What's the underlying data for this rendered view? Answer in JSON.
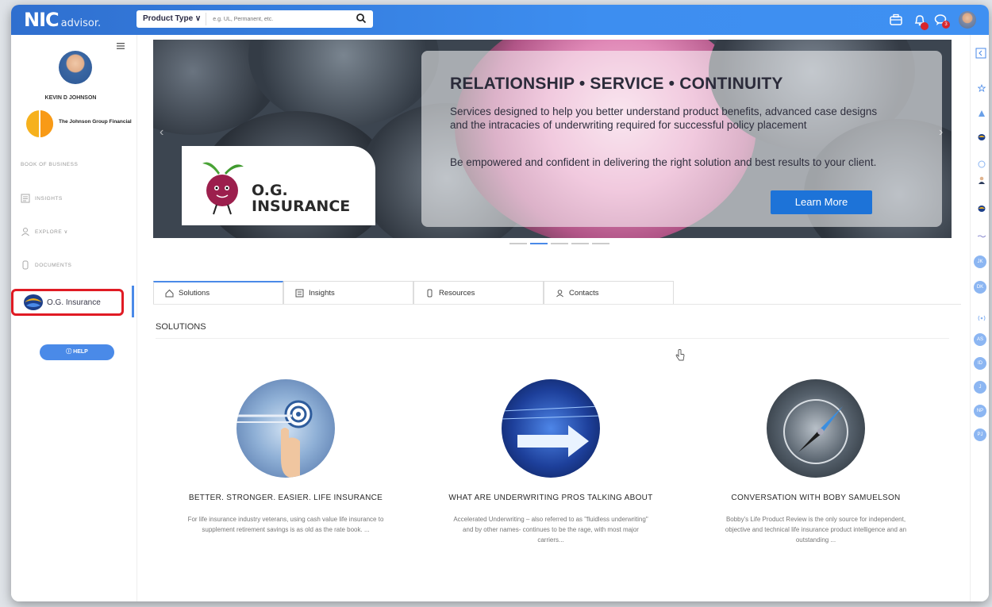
{
  "app": {
    "logo_main": "NIC",
    "logo_sub": "advisor."
  },
  "search": {
    "product_type": "Product Type ∨",
    "placeholder": "e.g. UL, Permanent, etc."
  },
  "topbar_icons": [
    "briefcase-icon",
    "bell-icon",
    "chat-icon",
    "user-avatar"
  ],
  "notifications": {
    "bell_badge": "",
    "chat_badge": "3"
  },
  "sidebar": {
    "user_name": "KEVIN D JOHNSON",
    "company_name": "The Johnson Group Financial",
    "items": [
      {
        "label": "BOOK OF BUSINESS"
      },
      {
        "label": "INSIGHTS"
      },
      {
        "label": "EXPLORE ∨"
      },
      {
        "label": "DOCUMENTS"
      }
    ],
    "active_item": "O.G. Insurance",
    "help_label": "HELP"
  },
  "banner": {
    "title": "RELATIONSHIP • SERVICE • CONTINUITY",
    "text1": "Services designed to help you better understand product benefits, advanced case designs and the intracacies of underwriting required for successful policy placement",
    "text2": "Be empowered and confident in delivering the right solution and best results to your client.",
    "button": "Learn More",
    "brand_line1": "O.G.",
    "brand_line2": "INSURANCE",
    "prev": "‹",
    "next": "›"
  },
  "tabs": [
    {
      "label": "Solutions",
      "icon": "home-icon"
    },
    {
      "label": "Insights",
      "icon": "list-icon"
    },
    {
      "label": "Resources",
      "icon": "document-icon"
    },
    {
      "label": "Contacts",
      "icon": "user-icon"
    }
  ],
  "section_title": "SOLUTIONS",
  "cards": [
    {
      "title": "BETTER. STRONGER. EASIER. LIFE INSURANCE",
      "text": "For life insurance industry veterans, using cash value life insurance to supplement retirement savings is as old as the rate book. ..."
    },
    {
      "title": "WHAT ARE UNDERWRITING PROS TALKING ABOUT",
      "text": "Accelerated Underwriting – also referred to as \"fluidless underwriting\" and by other names- continues to be the rage, with most major carriers..."
    },
    {
      "title": "CONVERSATION WITH BOBY SAMUELSON",
      "text": "Bobby's Life Product Review is the only source for independent, objective and technical life insurance product intelligence and an outstanding ..."
    }
  ],
  "rail_initials": [
    "JK",
    "DK",
    "AS",
    "ID",
    "J",
    "NP",
    "PJ"
  ],
  "colors": {
    "topbar": "#3d8ef0",
    "accent": "#4a8ae8",
    "highlight": "#e01b24",
    "learn_button": "#1d73d8"
  }
}
